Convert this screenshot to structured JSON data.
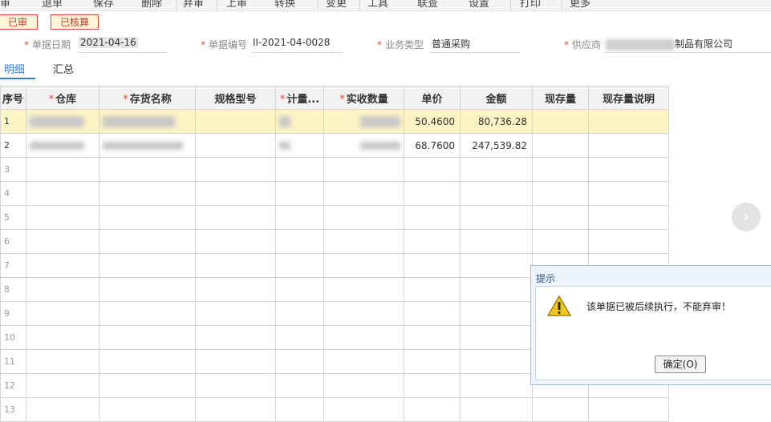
{
  "toolbar": {
    "items": [
      "审",
      "退单",
      "保存",
      "删除",
      "弃审",
      "上审",
      "转换",
      "变更",
      "工具",
      "联查",
      "设置",
      "打印",
      "更多"
    ]
  },
  "stamps": {
    "audited": "已审",
    "checked": "已核算"
  },
  "form": {
    "date_label": "单据日期",
    "date_value": "2021-04-16",
    "code_label": "单据编号",
    "code_value": "II-2021-04-0028",
    "biz_label": "业务类型",
    "biz_value": "普通采购",
    "supplier_label": "供应商",
    "supplier_suffix": "制品有限公司"
  },
  "tabs": {
    "detail": "明细",
    "summary": "汇总"
  },
  "table": {
    "headers": {
      "rownum": "序号",
      "warehouse": "仓库",
      "name": "存货名称",
      "spec": "规格型号",
      "unit": "计量...",
      "qty": "实收数量",
      "price": "单价",
      "amount": "金额",
      "stock": "现存量",
      "stock_note": "现存量说明"
    },
    "rows": [
      {
        "no": "1",
        "price": "50.4600",
        "amount": "80,736.28"
      },
      {
        "no": "2",
        "price": "68.7600",
        "amount": "247,539.82"
      },
      {
        "no": "3"
      },
      {
        "no": "4"
      },
      {
        "no": "5"
      },
      {
        "no": "6"
      },
      {
        "no": "7"
      },
      {
        "no": "8"
      },
      {
        "no": "9"
      },
      {
        "no": "10"
      },
      {
        "no": "11"
      },
      {
        "no": "12"
      },
      {
        "no": "13"
      }
    ]
  },
  "nav": {
    "next_icon": "chevron-right-icon",
    "next_glyph": "›"
  },
  "dialog": {
    "title": "提示",
    "icon": "warning-icon",
    "message": "该单据已被后续执行，不能弃审！",
    "ok_label": "确定(O)"
  },
  "colors": {
    "accent": "#2f7fd8",
    "selected_row": "#fdf4c6",
    "stamp": "#c0392b"
  }
}
